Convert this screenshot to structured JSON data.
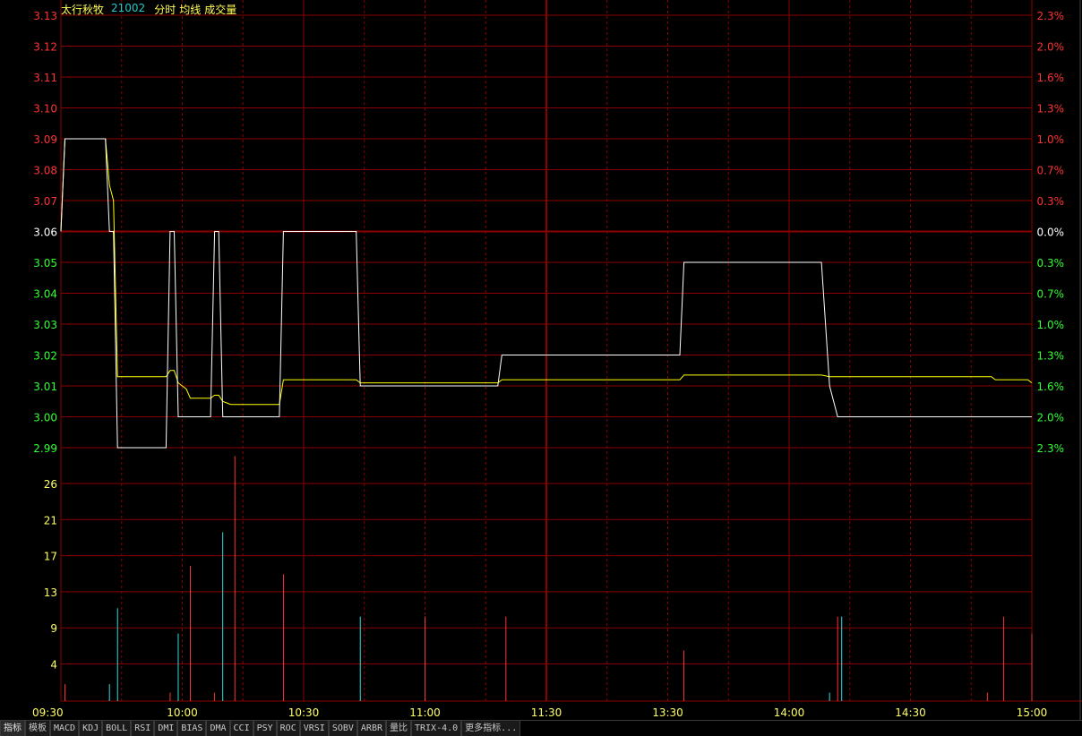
{
  "header": {
    "name": "太行秋牧",
    "code": "21002",
    "menus": [
      "分时",
      "均线",
      "成交量"
    ]
  },
  "colors": {
    "background": "#000000",
    "grid": "#8b0000",
    "price_line": "#ffffff",
    "avg_line": "#ffff00",
    "up": "#ff3333",
    "down": "#33ff33",
    "flat": "#ffffff",
    "vol_down": "#33dddd",
    "tick_text": "#ffff66"
  },
  "chart_data": {
    "type": "line",
    "price_axis": {
      "labels": [
        "3.13",
        "3.12",
        "3.11",
        "3.10",
        "3.09",
        "3.08",
        "3.07",
        "3.06",
        "3.05",
        "3.04",
        "3.03",
        "3.02",
        "3.01",
        "3.00",
        "2.99"
      ],
      "pct_labels": [
        "2.3%",
        "2.0%",
        "1.6%",
        "1.3%",
        "1.0%",
        "0.7%",
        "0.3%",
        "0.0%",
        "0.3%",
        "0.7%",
        "1.0%",
        "1.3%",
        "1.6%",
        "2.0%",
        "2.3%"
      ],
      "ylim": [
        2.99,
        3.13
      ],
      "reference_price": 3.06
    },
    "volume_axis": {
      "labels": [
        "26",
        "21",
        "17",
        "13",
        "9",
        "4"
      ],
      "ylim": [
        0,
        30
      ]
    },
    "time_axis": {
      "labels": [
        "09:30",
        "10:00",
        "10:30",
        "11:00",
        "11:30",
        "13:30",
        "14:00",
        "14:30",
        "15:00"
      ],
      "minutes_total": 240
    },
    "price_series": [
      [
        0,
        3.06
      ],
      [
        1,
        3.09
      ],
      [
        11,
        3.09
      ],
      [
        12,
        3.06
      ],
      [
        13,
        3.06
      ],
      [
        14,
        2.99
      ],
      [
        26,
        2.99
      ],
      [
        27,
        3.06
      ],
      [
        28,
        3.06
      ],
      [
        29,
        3.0
      ],
      [
        37,
        3.0
      ],
      [
        38,
        3.06
      ],
      [
        39,
        3.06
      ],
      [
        40,
        3.0
      ],
      [
        54,
        3.0
      ],
      [
        55,
        3.06
      ],
      [
        73,
        3.06
      ],
      [
        74,
        3.01
      ],
      [
        108,
        3.01
      ],
      [
        109,
        3.02
      ],
      [
        153,
        3.02
      ],
      [
        154,
        3.05
      ],
      [
        188,
        3.05
      ],
      [
        190,
        3.01
      ],
      [
        192,
        3.0
      ],
      [
        240,
        3.0
      ]
    ],
    "avg_series": [
      [
        0,
        3.06
      ],
      [
        1,
        3.09
      ],
      [
        11,
        3.09
      ],
      [
        12,
        3.075
      ],
      [
        13,
        3.07
      ],
      [
        14,
        3.013
      ],
      [
        26,
        3.013
      ],
      [
        27,
        3.015
      ],
      [
        28,
        3.015
      ],
      [
        29,
        3.011
      ],
      [
        31,
        3.009
      ],
      [
        32,
        3.006
      ],
      [
        37,
        3.006
      ],
      [
        38,
        3.007
      ],
      [
        39,
        3.007
      ],
      [
        40,
        3.005
      ],
      [
        42,
        3.004
      ],
      [
        54,
        3.004
      ],
      [
        55,
        3.012
      ],
      [
        73,
        3.012
      ],
      [
        74,
        3.011
      ],
      [
        108,
        3.011
      ],
      [
        109,
        3.012
      ],
      [
        153,
        3.012
      ],
      [
        154,
        3.0135
      ],
      [
        188,
        3.0135
      ],
      [
        190,
        3.013
      ],
      [
        230,
        3.013
      ],
      [
        231,
        3.012
      ],
      [
        239,
        3.012
      ],
      [
        240,
        3.011
      ]
    ],
    "volume_bars": [
      {
        "t": 1,
        "v": 2,
        "c": "up"
      },
      {
        "t": 12,
        "v": 2,
        "c": "down"
      },
      {
        "t": 14,
        "v": 11,
        "c": "down"
      },
      {
        "t": 27,
        "v": 1,
        "c": "up"
      },
      {
        "t": 29,
        "v": 8,
        "c": "down"
      },
      {
        "t": 32,
        "v": 16,
        "c": "up"
      },
      {
        "t": 38,
        "v": 1,
        "c": "up"
      },
      {
        "t": 40,
        "v": 20,
        "c": "down"
      },
      {
        "t": 43,
        "v": 29,
        "c": "up"
      },
      {
        "t": 55,
        "v": 15,
        "c": "up"
      },
      {
        "t": 74,
        "v": 10,
        "c": "down"
      },
      {
        "t": 90,
        "v": 10,
        "c": "up"
      },
      {
        "t": 110,
        "v": 10,
        "c": "up"
      },
      {
        "t": 154,
        "v": 6,
        "c": "up"
      },
      {
        "t": 190,
        "v": 1,
        "c": "down"
      },
      {
        "t": 192,
        "v": 10,
        "c": "up"
      },
      {
        "t": 193,
        "v": 10,
        "c": "down"
      },
      {
        "t": 229,
        "v": 1,
        "c": "up"
      },
      {
        "t": 233,
        "v": 10,
        "c": "up"
      },
      {
        "t": 240,
        "v": 8,
        "c": "up"
      }
    ]
  },
  "bottom_tabs": [
    "指标",
    "模板",
    "MACD",
    "KDJ",
    "BOLL",
    "RSI",
    "DMI",
    "BIAS",
    "DMA",
    "CCI",
    "PSY",
    "ROC",
    "VRSI",
    "SOBV",
    "ARBR",
    "量比",
    "TRIX-4.0",
    "更多指标..."
  ]
}
